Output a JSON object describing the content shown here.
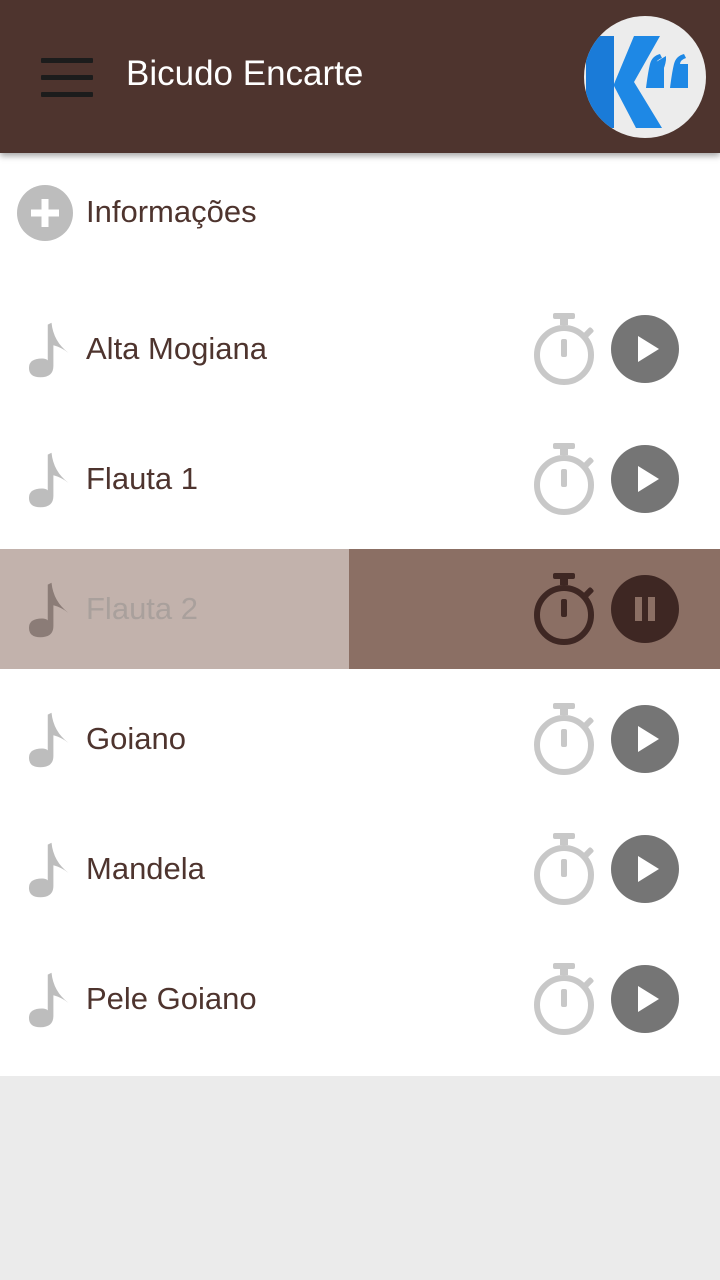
{
  "app": {
    "title": "Bicudo Encarte",
    "menu_icon": "hamburger-menu-icon",
    "logo_letter": "K",
    "logo_quote": "“"
  },
  "info": {
    "label": "Informações",
    "icon": "add-circle-icon"
  },
  "tracks": [
    {
      "name": "Alta Mogiana",
      "state": "stopped"
    },
    {
      "name": "Flauta 1",
      "state": "stopped"
    },
    {
      "name": "Flauta 2",
      "state": "playing"
    },
    {
      "name": "Goiano",
      "state": "stopped"
    },
    {
      "name": "Mandela",
      "state": "stopped"
    },
    {
      "name": "Pele Goiano",
      "state": "stopped"
    }
  ],
  "colors": {
    "appbar": "#4e342e",
    "text": "#4e342e",
    "playing_left": "#c2b2ac",
    "playing_right": "#8b6f64",
    "play_button": "#757575",
    "icon_grey": "#bdbdbd",
    "logo_blue": "#1e88e5"
  }
}
